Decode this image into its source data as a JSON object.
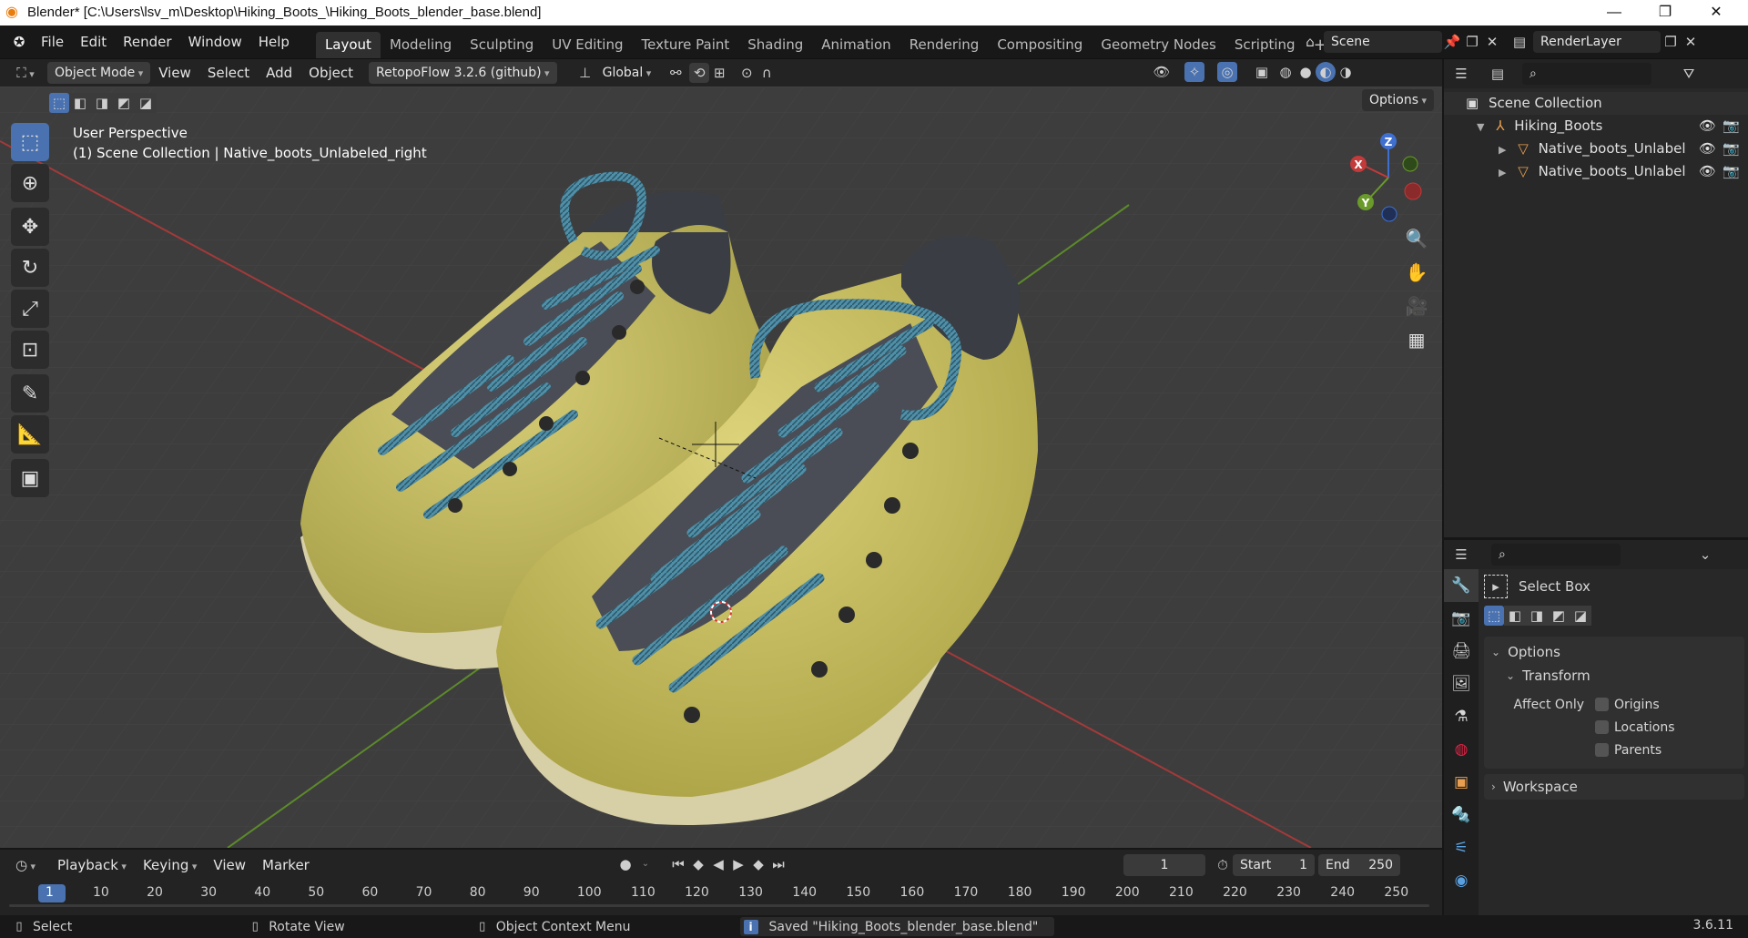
{
  "titlebar": {
    "title": "Blender* [C:\\Users\\lsv_m\\Desktop\\Hiking_Boots_\\Hiking_Boots_blender_base.blend]",
    "minimize": "—",
    "maximize": "❐",
    "close": "✕"
  },
  "menu": [
    "File",
    "Edit",
    "Render",
    "Window",
    "Help"
  ],
  "workspaces": [
    "Layout",
    "Modeling",
    "Sculpting",
    "UV Editing",
    "Texture Paint",
    "Shading",
    "Animation",
    "Rendering",
    "Compositing",
    "Geometry Nodes",
    "Scripting"
  ],
  "add_workspace": "+",
  "scene": {
    "label": "Scene",
    "render_layer": "RenderLayer"
  },
  "header": {
    "mode": "Object Mode",
    "view": "View",
    "select": "Select",
    "add": "Add",
    "object": "Object",
    "addon": "RetopoFlow 3.2.6 (github)",
    "orientation": "Global",
    "options": "Options"
  },
  "viewport": {
    "perspective": "User Perspective",
    "collection_info": "(1) Scene Collection | Native_boots_Unlabeled_right",
    "gizmo": {
      "x": "X",
      "y": "Y",
      "z": "Z"
    }
  },
  "outliner": {
    "root": "Scene Collection",
    "items": [
      {
        "label": "Hiking_Boots"
      },
      {
        "label": "Native_boots_Unlabel"
      },
      {
        "label": "Native_boots_Unlabel"
      }
    ]
  },
  "properties": {
    "tool_name": "Select Box",
    "options": "Options",
    "transform": "Transform",
    "affect_only": "Affect Only",
    "origins": "Origins",
    "locations": "Locations",
    "parents": "Parents",
    "workspace": "Workspace"
  },
  "timeline": {
    "playback": "Playback",
    "keying": "Keying",
    "view": "View",
    "marker": "Marker",
    "current_frame": "1",
    "start_label": "Start",
    "start": "1",
    "end_label": "End",
    "end": "250",
    "ruler": [
      "1",
      "10",
      "20",
      "30",
      "40",
      "50",
      "60",
      "70",
      "80",
      "90",
      "100",
      "110",
      "120",
      "130",
      "140",
      "150",
      "160",
      "170",
      "180",
      "190",
      "200",
      "210",
      "220",
      "230",
      "240",
      "250"
    ]
  },
  "status": {
    "select": "Select",
    "rotate": "Rotate View",
    "context": "Object Context Menu",
    "message": "Saved \"Hiking_Boots_blender_base.blend\"",
    "version": "3.6.11"
  },
  "colors": {
    "accent": "#4a72b0",
    "boot_leather": "#c8c060",
    "laces": "#4f8fa8",
    "sole": "#d8cfa8",
    "x_axis": "#c23a3a",
    "y_axis": "#6a9a2a",
    "z_axis": "#3f6fcf"
  }
}
